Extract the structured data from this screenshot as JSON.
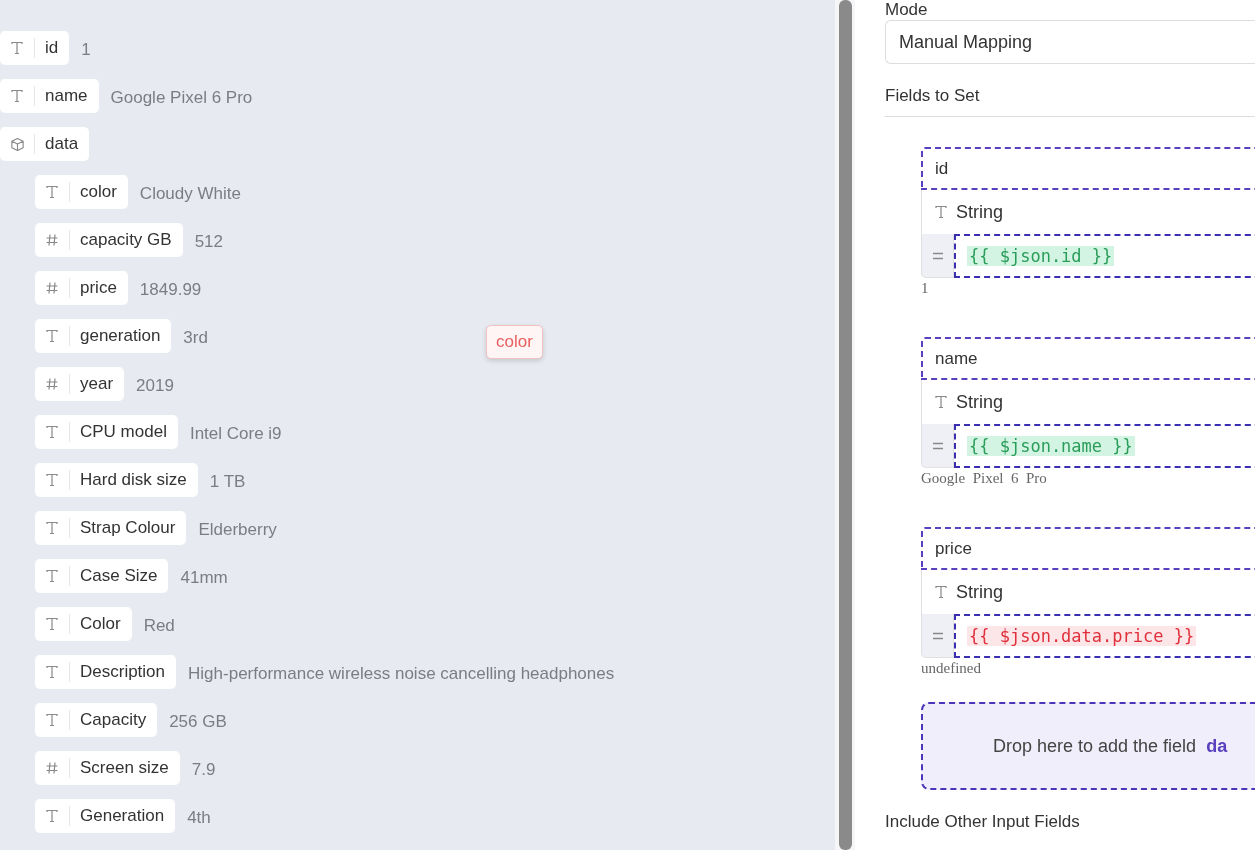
{
  "input_tree": [
    {
      "kind": "string",
      "key": "id",
      "value": "1"
    },
    {
      "kind": "string",
      "key": "name",
      "value": "Google Pixel 6 Pro"
    },
    {
      "kind": "object",
      "key": "data",
      "children": [
        {
          "kind": "string",
          "key": "color",
          "value": "Cloudy White"
        },
        {
          "kind": "number",
          "key": "capacity GB",
          "value": "512"
        },
        {
          "kind": "number",
          "key": "price",
          "value": "1849.99"
        },
        {
          "kind": "string",
          "key": "generation",
          "value": "3rd"
        },
        {
          "kind": "number",
          "key": "year",
          "value": "2019"
        },
        {
          "kind": "string",
          "key": "CPU model",
          "value": "Intel Core i9"
        },
        {
          "kind": "string",
          "key": "Hard disk size",
          "value": "1 TB"
        },
        {
          "kind": "string",
          "key": "Strap Colour",
          "value": "Elderberry"
        },
        {
          "kind": "string",
          "key": "Case Size",
          "value": "41mm"
        },
        {
          "kind": "string",
          "key": "Color",
          "value": "Red"
        },
        {
          "kind": "string",
          "key": "Description",
          "value": "High-performance wireless noise cancelling headphones"
        },
        {
          "kind": "string",
          "key": "Capacity",
          "value": "256 GB"
        },
        {
          "kind": "number",
          "key": "Screen size",
          "value": "7.9"
        },
        {
          "kind": "string",
          "key": "Generation",
          "value": "4th"
        }
      ]
    }
  ],
  "drag_chip": "color",
  "settings": {
    "mode_label": "Mode",
    "mode_value": "Manual Mapping",
    "fields_heading": "Fields to Set",
    "fields": [
      {
        "name": "id",
        "type": "String",
        "expression": "{{ $json.id }}",
        "error": false,
        "result": "1"
      },
      {
        "name": "name",
        "type": "String",
        "expression": "{{ $json.name }}",
        "error": false,
        "result": "Google  Pixel  6  Pro"
      },
      {
        "name": "price",
        "type": "String",
        "expression": "{{ $json.data.price }}",
        "error": true,
        "result": "undefined"
      }
    ],
    "drop_zone": {
      "text": "Drop here to add the field",
      "field": "da"
    },
    "include_label": "Include Other Input Fields"
  }
}
